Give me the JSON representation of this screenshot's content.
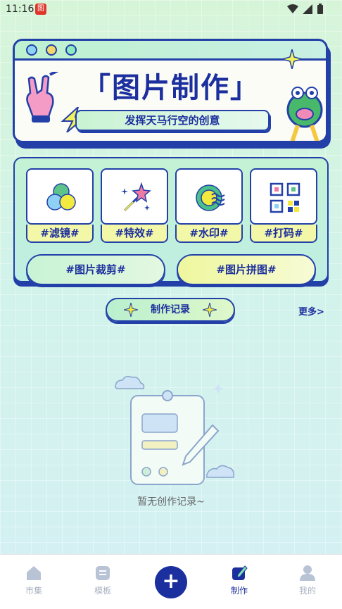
{
  "status_bar": {
    "time": "11:16",
    "app_icon_label": "图"
  },
  "banner": {
    "title": "「图片制作」",
    "subtitle": "发挥天马行空的创意"
  },
  "tools": [
    {
      "label": "#滤镜#",
      "icon": "filter-circles-icon"
    },
    {
      "label": "#特效#",
      "icon": "magic-wand-star-icon"
    },
    {
      "label": "#水印#",
      "icon": "watermark-icon"
    },
    {
      "label": "#打码#",
      "icon": "mosaic-qr-icon"
    }
  ],
  "wide_buttons": {
    "crop": "#图片裁剪#",
    "collage": "#图片拼图#"
  },
  "records": {
    "button_label": "制作记录",
    "more_link": "更多>"
  },
  "empty_state": {
    "text": "暂无创作记录~"
  },
  "bottom_nav": {
    "items": [
      {
        "label": "市集",
        "icon": "house-icon"
      },
      {
        "label": "模板",
        "icon": "template-icon"
      },
      {
        "label": "制作",
        "icon": "edit-icon",
        "active": true
      },
      {
        "label": "我的",
        "icon": "user-icon"
      }
    ],
    "center_label": "+"
  },
  "colors": {
    "primary": "#1c2f9e",
    "label_yellow": "#f3f7a8",
    "mint": "#c4f2d4"
  }
}
